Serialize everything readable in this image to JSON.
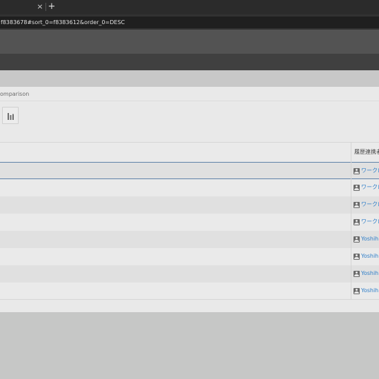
{
  "browser": {
    "tab_close_glyph": "×",
    "new_tab_glyph": "+",
    "url": "f8383678#sort_0=f8383612&order_0=DESC"
  },
  "panel": {
    "breadcrumb": "omparison",
    "chart_button_icon": "bar-chart-icon"
  },
  "grid": {
    "columns": [
      "履歴連携者"
    ],
    "selected_row": 0,
    "rows": [
      {
        "user": "ワークロ",
        "icon": "user-icon"
      },
      {
        "user": "ワークロ",
        "icon": "user-icon"
      },
      {
        "user": "ワークロ",
        "icon": "user-icon"
      },
      {
        "user": "ワークロ",
        "icon": "user-icon"
      },
      {
        "user": "Yoshihi",
        "icon": "user-icon"
      },
      {
        "user": "Yoshihi",
        "icon": "user-icon"
      },
      {
        "user": "Yoshihi",
        "icon": "user-icon"
      },
      {
        "user": "Yoshihi",
        "icon": "user-icon"
      }
    ]
  },
  "colors": {
    "link": "#2e7ec9",
    "selection_border": "#5d80a8",
    "tab_bar": "#2b2b2b",
    "toolbar": "#535353",
    "app_header": "#404040"
  }
}
